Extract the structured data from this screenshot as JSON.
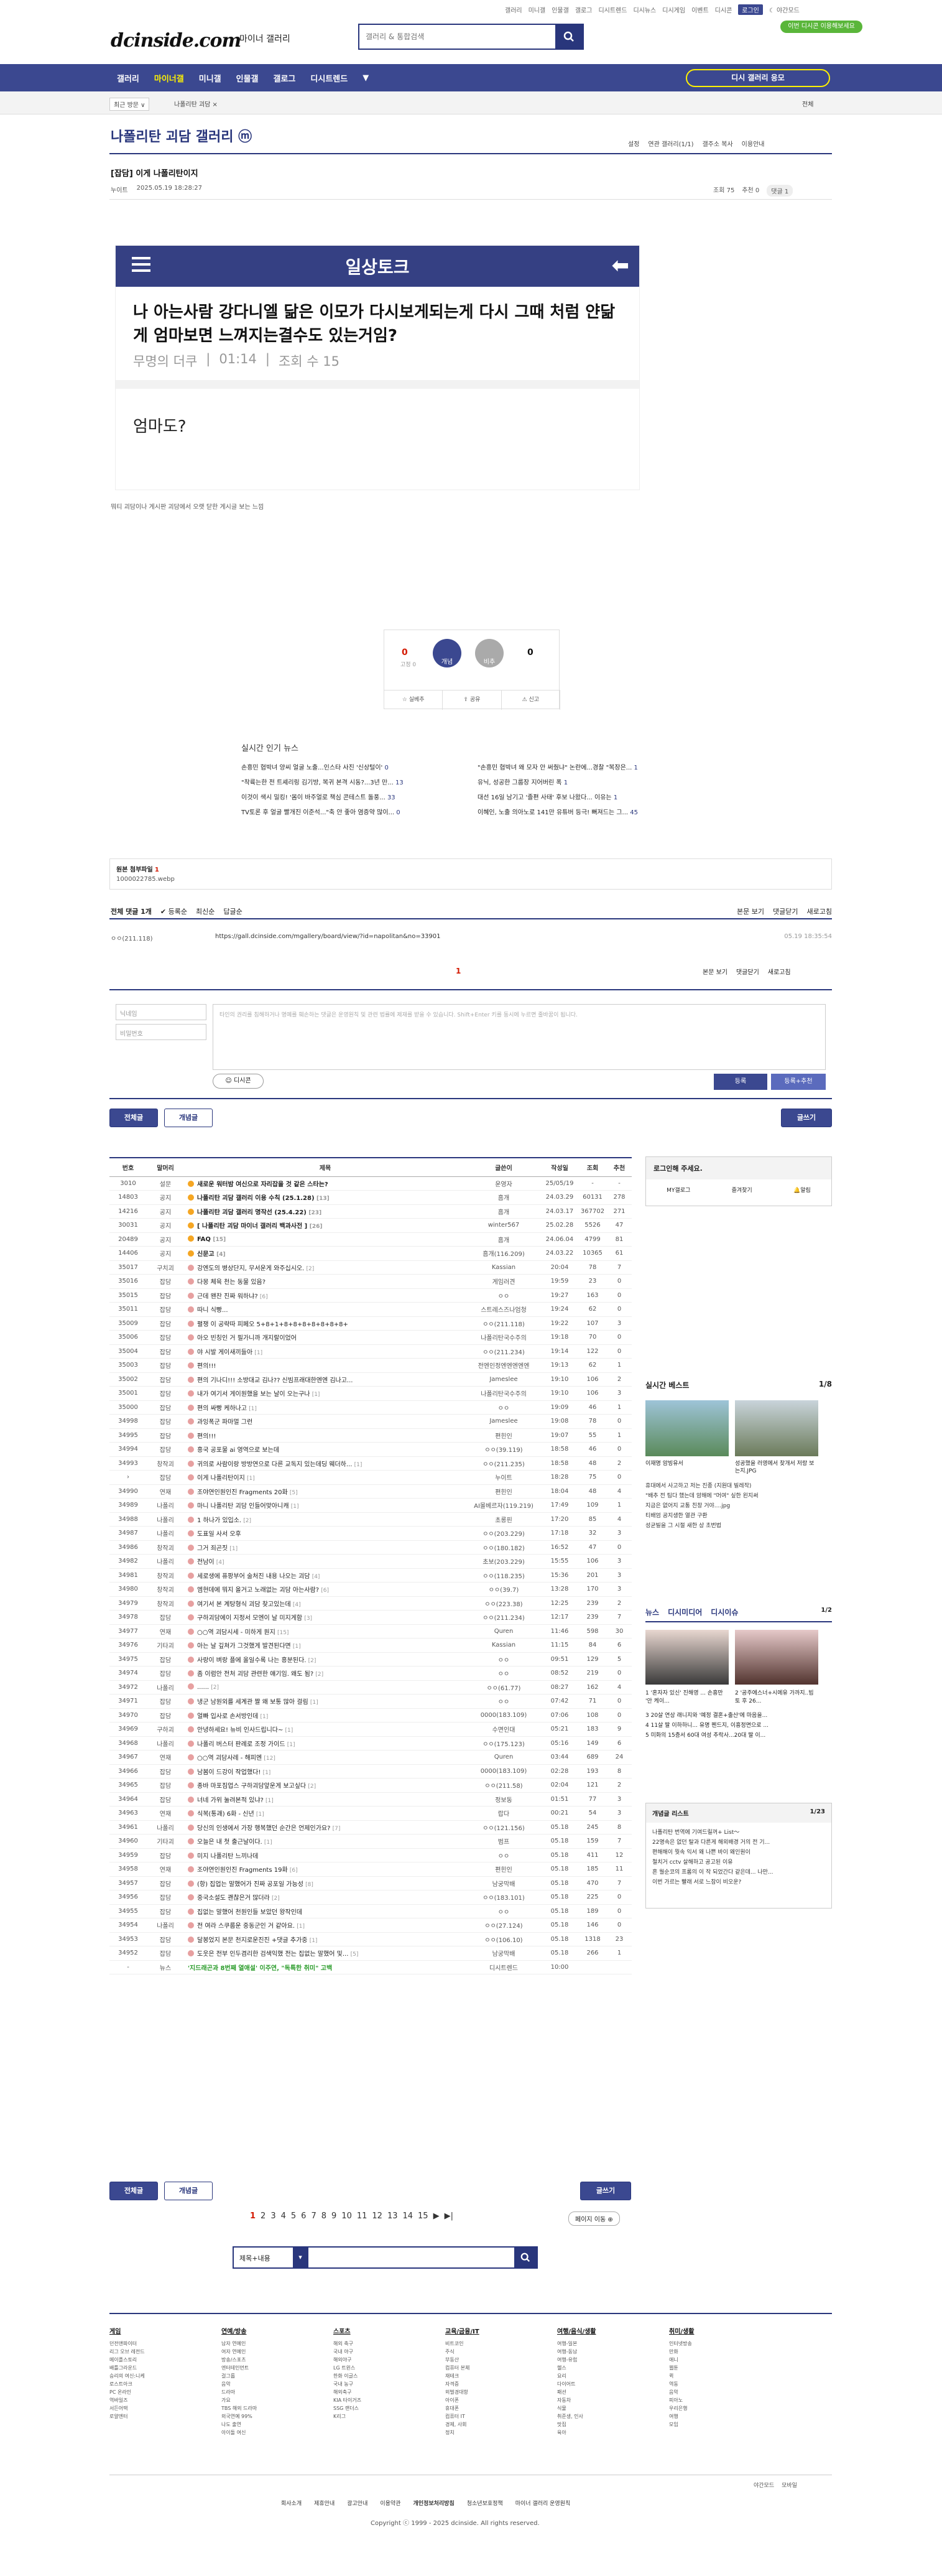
{
  "util": {
    "links": [
      "갤러리",
      "미니갤",
      "인물갤",
      "갤로그",
      "디시트렌드",
      "디시뉴스",
      "디시게임",
      "이벤트",
      "디시콘"
    ],
    "active": "로그인",
    "dark": "야간모드",
    "promo": "이번 디시콘 이용해보세요"
  },
  "header": {
    "logo": "dcinside.com",
    "logo_sub": "마이너 갤러리",
    "search_placeholder": "갤러리 & 통합검색"
  },
  "gnb": {
    "items": [
      "갤러리",
      "마이너갤",
      "미니갤",
      "인물갤",
      "갤로그",
      "디시트렌드",
      "▼"
    ],
    "active": 1,
    "write": "디시 갤러리 응모"
  },
  "subbar": {
    "s1": "최근 방문 ∨",
    "s2": "나폴리탄 괴담 ×",
    "s3": "전체"
  },
  "gallery": {
    "title": "나폴리탄 괴담 갤러리 ⓜ",
    "opts": [
      "설정",
      "연관 갤러리(1/1)",
      "갤주소 복사",
      "이용안내"
    ]
  },
  "post": {
    "title": "[잡담] 이게 나폴리탄이지",
    "author": "누이트",
    "date": "2025.05.19 18:28:27",
    "views": "조회 75",
    "recs": "추천 0",
    "comments": "댓글 1",
    "caption": "뭐티 괴담이나 게시판 괴담에서 오랫 닫한 게시글 보는 느낌"
  },
  "embed": {
    "header": "일상토크",
    "question": "나 아는사람 강다니엘 닮은 이모가 다시보게되는게 다시 그때 처럼 얀닮게 엄마보면 느껴지는결수도 있는거임?",
    "meta": [
      "무명의 더쿠",
      "01:14",
      "조회 수 15"
    ],
    "answer": "엄마도?"
  },
  "vote": {
    "up": "0",
    "up_sub": "고정 0",
    "up_label": "개념",
    "down_label": "비추",
    "down": "0",
    "buttons": [
      "실베추",
      "공유",
      "신고"
    ]
  },
  "news": {
    "title": "실시간 인기 뉴스",
    "left": [
      [
        "손흥민 협박녀 양씨 얼굴 노출...인스타 사진 '신상털이'",
        "0"
      ],
      [
        "\"착륙는한 전 트셰리링 김기방, 복귀 본격 시동?...3년 만...",
        "13"
      ],
      [
        "이것이 색시 밀킹! '몸이 바주얼로 책심 콘테스트 돌풍...",
        "33"
      ],
      [
        "TV토론 후 얼굴 빨개진 이준석...\"축 안 좋아 염증약 많이...",
        "0"
      ]
    ],
    "right": [
      [
        "\"손흥민 협박녀 왜 모자 안 써줬냐\" 논란에...경찰 \"복장은...",
        "1"
      ],
      [
        "유닉, 성공한 그룹장 지어버린 폭",
        "1"
      ],
      [
        "대선 16일 남기고 '졸편 사태' 후보 나왔다... 이유는",
        "1"
      ],
      [
        "이혜인, 노출 의아노로 141만 유튜버 등극! 뻐져드는 그...",
        "45"
      ]
    ]
  },
  "attach": {
    "label": "원본 첨부파일",
    "count": "1",
    "file": "1000022785.webp"
  },
  "comments": {
    "total": "전체 댓글 1개",
    "sort": [
      "등록순",
      "최신순",
      "답글순"
    ],
    "right": [
      "본문 보기",
      "댓글닫기",
      "새로고침"
    ],
    "author": "ㅇㅇ(211.118)",
    "url": "https://gall.dcinside.com/mgallery/board/view/?id=napolitan&no=33901",
    "date": "05.19 18:35:54",
    "page": "1",
    "nick_ph": "닉네임",
    "pw_ph": "비밀번호",
    "ta_ph": "타인의 권리를 침해하거나 명예를 훼손하는 댓글은 운영원칙 및 관련 법률에 제재를 받을 수 있습니다. Shift+Enter 키를 동시에 누르면 줄바꿈이 됩니다.",
    "dccon": "디시콘",
    "submit": "등록",
    "submit2": "등록+추천"
  },
  "buttons": {
    "all": "전체글",
    "rec": "개념글",
    "write": "글쓰기"
  },
  "list": {
    "headers": [
      "번호",
      "말머리",
      "제목",
      "글쓴이",
      "작성일",
      "조회",
      "추천"
    ],
    "rows": [
      [
        "3010",
        "설문",
        "새로운 워터밤 여신으로 자리잡을 것 같은 스타는?",
        "",
        "운영자",
        "25/05/19",
        "-",
        "-",
        "y",
        "n"
      ],
      [
        "14803",
        "공지",
        "나폴리탄 괴담 갤러리 이용 수칙 (25.1.28)",
        "[13]",
        "흠개",
        "24.03.29",
        "60131",
        "278",
        "y",
        "n"
      ],
      [
        "14216",
        "공지",
        "나폴리탄 괴담 갤러리 명작선 (25.4.22)",
        "[23]",
        "흠개",
        "24.03.17",
        "367702",
        "271",
        "y",
        "n"
      ],
      [
        "30031",
        "공지",
        "[ 나폴리탄 괴담 마이너 갤러리 백과사전 ]",
        "[26]",
        "winter567",
        "25.02.28",
        "5526",
        "47",
        "y",
        "n"
      ],
      [
        "20489",
        "공지",
        "FAQ",
        "[15]",
        "흠개",
        "24.06.04",
        "4799",
        "81",
        "y",
        "n"
      ],
      [
        "14406",
        "공지",
        "신문고",
        "[4]",
        "흠개(116.209)",
        "24.03.22",
        "10365",
        "61",
        "y",
        "n"
      ],
      [
        "35017",
        "구치괴",
        "강엔도의 병상단지, 무서운게 와주십시오.",
        "[2]",
        "Kassian",
        "20:04",
        "78",
        "7",
        "p",
        ""
      ],
      [
        "35016",
        "잡담",
        "다몽 체육 천는 동물 있음?",
        "",
        "게임러견",
        "19:59",
        "23",
        "0",
        "p",
        ""
      ],
      [
        "35015",
        "잡담",
        "근데 왠찬 진짜 워하냐?",
        "[6]",
        "ㅇㅇ",
        "19:27",
        "163",
        "0",
        "p",
        ""
      ],
      [
        "35011",
        "잡담",
        "따니 식빵...",
        "",
        "스트레스즈나엄청",
        "19:24",
        "62",
        "0",
        "p",
        ""
      ],
      [
        "35009",
        "잡담",
        "펼쟁 이 공략따 피페오 5+8+1+8+8+8+8+8+8+8+",
        "",
        "ㅇㅇ(211.118)",
        "19:22",
        "107",
        "3",
        "p",
        ""
      ],
      [
        "35006",
        "잡담",
        "아오 빈칭인 거 필가니까 개지랄이었어",
        "",
        "나폴리탄국수주의",
        "19:18",
        "70",
        "0",
        "p",
        ""
      ],
      [
        "35004",
        "잡담",
        "야 시발 게이새끼들아",
        "[1]",
        "ㅇㅇ(211.234)",
        "19:14",
        "122",
        "0",
        "p",
        ""
      ],
      [
        "35003",
        "잡담",
        "편의!!!",
        "",
        "전엔인정엔엔엔엔엔",
        "19:13",
        "62",
        "1",
        "p",
        ""
      ],
      [
        "35002",
        "잡담",
        "편의 기나디!!! 소방대교 김나?? 신빔프래대한엔엔 김나고...",
        "",
        "Jameslee",
        "19:10",
        "106",
        "2",
        "p",
        ""
      ],
      [
        "35001",
        "잡담",
        "내가 여기서 게이원했을 보는 날이 오는구나",
        "[1]",
        "나폴리탄국수주의",
        "19:10",
        "106",
        "3",
        "p",
        ""
      ],
      [
        "35000",
        "잡담",
        "편의 싸빵 케하나고",
        "[1]",
        "ㅇㅇ",
        "19:09",
        "46",
        "1",
        "p",
        ""
      ],
      [
        "34998",
        "잡담",
        "과잉폭군 파마멀 그런",
        "",
        "Jameslee",
        "19:08",
        "78",
        "0",
        "p",
        ""
      ],
      [
        "34995",
        "잡담",
        "편의!!!",
        "",
        "편힌인",
        "19:07",
        "55",
        "1",
        "p",
        ""
      ],
      [
        "34994",
        "잡담",
        "흥국 공포물 ai 영역으로 보는데",
        "",
        "ㅇㅇ(39.119)",
        "18:58",
        "46",
        "0",
        "p",
        ""
      ],
      [
        "34993",
        "창작괴",
        "귀의로 사람이랑 방방연으로 다른 교독지 있는데딩 웨더하...",
        "[1]",
        "ㅇㅇ(211.235)",
        "18:58",
        "48",
        "2",
        "p",
        ""
      ],
      [
        "›",
        "잡담",
        "이게 나폴리탄이지",
        "[1]",
        "누이트",
        "18:28",
        "75",
        "0",
        "p",
        ""
      ],
      [
        "34990",
        "연재",
        "조야연인원인진 Fragments 20화",
        "[5]",
        "편힌인",
        "18:04",
        "48",
        "4",
        "p",
        ""
      ],
      [
        "34989",
        "나폴리",
        "마니 나폴리탄 괴담 인들어맞아니캐",
        "[1]",
        "AI몰베르자(119.219)",
        "17:49",
        "109",
        "1",
        "p",
        ""
      ],
      [
        "34988",
        "나폴리",
        "1 하나가 있입소.",
        "[2]",
        "초롱핀",
        "17:20",
        "85",
        "4",
        "p",
        ""
      ],
      [
        "34987",
        "나폴리",
        "도표일 사서 오후",
        "",
        "ㅇㅇ(203.229)",
        "17:18",
        "32",
        "3",
        "p",
        ""
      ],
      [
        "34986",
        "창작괴",
        "그거 죄곤짓",
        "[1]",
        "ㅇㅇ(180.182)",
        "16:52",
        "47",
        "0",
        "p",
        ""
      ],
      [
        "34982",
        "나폴리",
        "전남이",
        "[4]",
        "초보(203.229)",
        "15:55",
        "106",
        "3",
        "p",
        ""
      ],
      [
        "34981",
        "창작괴",
        "세로생에 퓨팡부어 술처진 내용 나오는 괴담",
        "[4]",
        "ㅇㅇ(118.235)",
        "15:36",
        "201",
        "3",
        "p",
        ""
      ],
      [
        "34980",
        "창작괴",
        "엠현데에 뭐지 올거고 노래없는 괴담 아는사람?",
        "[6]",
        "ㅇㅇ(39.7)",
        "13:28",
        "170",
        "3",
        "p",
        ""
      ],
      [
        "34979",
        "창작괴",
        "여기서 본 계탕형식 괴담 찾고있는데",
        "[4]",
        "ㅇㅇ(223.38)",
        "12:25",
        "239",
        "2",
        "p",
        ""
      ],
      [
        "34978",
        "잡담",
        "구하괴담에이 지정서 모엔이 날 미지게함",
        "[3]",
        "ㅇㅇ(211.234)",
        "12:17",
        "239",
        "7",
        "p",
        ""
      ],
      [
        "34977",
        "연재",
        "○○역 괴담시세 - 미하게 원지",
        "[15]",
        "Quren",
        "11:46",
        "598",
        "30",
        "p",
        ""
      ],
      [
        "34976",
        "기타괴",
        "아는 날 깊쳐가 그것했게 발견된다면",
        "[1]",
        "Kassian",
        "11:15",
        "84",
        "6",
        "p",
        ""
      ],
      [
        "34975",
        "잡담",
        "사랑이 벼랑 플에 올일수록 나는 흥분된다.",
        "[2]",
        "ㅇㅇ",
        "09:51",
        "129",
        "5",
        "p",
        ""
      ],
      [
        "34974",
        "잡담",
        "좀 이럼안 전처 괴담 관련한 얘기임. 왜도 됨?",
        "[2]",
        "ㅇㅇ",
        "08:52",
        "219",
        "0",
        "p",
        ""
      ],
      [
        "34972",
        "나폴리",
        "......",
        "[2]",
        "ㅇㅇ(61.77)",
        "08:27",
        "162",
        "4",
        "p",
        ""
      ],
      [
        "34971",
        "잡담",
        "냉군 남원외를 세계관 짤 왜 보통 많아 걸림",
        "[1]",
        "ㅇㅇ",
        "07:42",
        "71",
        "0",
        "p",
        ""
      ],
      [
        "34970",
        "잡담",
        "얼빠 입사로 손서방인데",
        "[1]",
        "0000(183.109)",
        "07:06",
        "108",
        "0",
        "p",
        ""
      ],
      [
        "34969",
        "구하괴",
        "안녕하세요! 뉴비 인사드립니다~",
        "[1]",
        "수면인대",
        "05:21",
        "183",
        "9",
        "p",
        ""
      ],
      [
        "34968",
        "나폴리",
        "나폴리 버스터 판례로 조정 가이드",
        "[1]",
        "ㅇㅇ(175.123)",
        "05:16",
        "149",
        "6",
        "p",
        ""
      ],
      [
        "34967",
        "연재",
        "○○역 괴담사레 - 해피엔",
        "[12]",
        "Quren",
        "03:44",
        "689",
        "24",
        "p",
        ""
      ],
      [
        "34966",
        "잡담",
        "남봄이 드강이 작업했다!",
        "[1]",
        "0000(183.109)",
        "02:28",
        "193",
        "8",
        "p",
        ""
      ],
      [
        "34965",
        "잡담",
        "종바 마포짐업스 구하괴담앞운게 보고싶다",
        "[2]",
        "ㅇㅇ(211.58)",
        "02:04",
        "121",
        "2",
        "p",
        ""
      ],
      [
        "34964",
        "잡담",
        "너네 가위 눌려본적 있냐?",
        "[1]",
        "정보동",
        "01:51",
        "77",
        "3",
        "p",
        ""
      ],
      [
        "34963",
        "연재",
        "식복(통괘) 6화 - 신년",
        "[1]",
        "랍다",
        "00:21",
        "54",
        "3",
        "p",
        ""
      ],
      [
        "34961",
        "나폴리",
        "당신의 인생에서 가장 행복했던 순간은 언제인가요?",
        "[7]",
        "ㅇㅇ(121.156)",
        "05.18",
        "245",
        "8",
        "p",
        ""
      ],
      [
        "34960",
        "기타괴",
        "오늘은 내 첫 출근날이다.",
        "[1]",
        "범프",
        "05.18",
        "159",
        "7",
        "p",
        ""
      ],
      [
        "34959",
        "잡담",
        "미지 나폴리탄 느끼나데",
        "",
        "ㅇㅇ",
        "05.18",
        "411",
        "12",
        "p",
        ""
      ],
      [
        "34958",
        "연재",
        "조야연인원인진 Fragments 19화",
        "[6]",
        "편힌인",
        "05.18",
        "185",
        "11",
        "p",
        ""
      ],
      [
        "34957",
        "잡담",
        "(항) 집업는 말했어가 진짜 공포일 가능성",
        "[8]",
        "남궁막배",
        "05.18",
        "470",
        "7",
        "p",
        ""
      ],
      [
        "34956",
        "잡담",
        "중국소설도 괜찮은거 많더라",
        "[2]",
        "ㅇㅇ(183.101)",
        "05.18",
        "225",
        "0",
        "p",
        ""
      ],
      [
        "34955",
        "잡담",
        "집없는 말했어 천원인들 보았던 왕작인데",
        "",
        "ㅇㅇ",
        "05.18",
        "189",
        "0",
        "p",
        ""
      ],
      [
        "34954",
        "나폴리",
        "전 여라 스쿠룹운 중동군인 거 같아요.",
        "[1]",
        "ㅇㅇ(27.124)",
        "05.18",
        "146",
        "0",
        "p",
        ""
      ],
      [
        "34953",
        "잡담",
        "달봉었지 본문 천지로운진진 +댓글 추가중",
        "[1]",
        "ㅇㅇ(106.10)",
        "05.18",
        "1318",
        "23",
        "p",
        ""
      ],
      [
        "34952",
        "잡담",
        "도웃은 전부 인두겸리한 검색익했 전는 집없는 말했어 및...",
        "[5]",
        "남궁막배",
        "05.18",
        "266",
        "1",
        "p",
        ""
      ],
      [
        "-",
        "뉴스",
        "'지드래곤과 8번째 열애설' 이주연, \"독특한 취미\" 고백",
        "",
        "디시트렌드",
        "10:00",
        "",
        "",
        " ",
        "g"
      ]
    ]
  },
  "side": {
    "login": {
      "title": "로그인해 주세요.",
      "items": [
        "MY갤로그",
        "즐겨찾기",
        "알림"
      ]
    },
    "best": {
      "title": "실시간 베스트",
      "page": "1/8",
      "caps": [
        "이재명 암빙유서",
        "성공했을 러영에서 찾개서 저랑 보는지.JPG"
      ],
      "items": [
        "휴대에서 사고하고 저는 진종 (지원대 빌레작)",
        "\"배추 전 팀다 했는데 암해에 \"머여\" 싶한 왼지써",
        "지금은 없어지 교통 친창 거야....jpg",
        "티배엄 공지생한 열관 구환",
        "성균빌을 그 시절 새한 상 초번법"
      ]
    },
    "news": {
      "tabs": [
        "뉴스",
        "디시미디어",
        "디시이슈"
      ],
      "page": "1/2",
      "caps": [
        "1 '혼자자 있신' 진해영 ... 손흥만 '안 케이...",
        "2 '공주에스너+시에유 가까지..빔토 후 26..."
      ],
      "items": [
        "3 20살 연상 래니지와 '예정 결혼+출산'에 마음을...",
        "4 11살 딸 이하하니... 유명 펜드지, 이흥정면으로 ...",
        "5 미화의 15층서 60대 여성 추락사...20대 딸 이..."
      ]
    },
    "gbox": {
      "title": "개념글 리스트",
      "page": "1/23",
      "items": [
        "나폴리탄 번역에 기여드릴꺼+ List～",
        "22명속은 없던 탈과 다른게 해외배경 거의 전 기...",
        "편해해이 뭣속 익서 왜 나쁜 바이 왜인원이",
        "철치거 cctv 살해하고 공고된 이유",
        "흔 월순코의 프롬의 이 작 되었간다 같은데... 나만...",
        "이번 가르는 빨래 서로 느참이 비오운?"
      ]
    }
  },
  "pager": {
    "pages": [
      "1",
      "2",
      "3",
      "4",
      "5",
      "6",
      "7",
      "8",
      "9",
      "10",
      "11",
      "12",
      "13",
      "14",
      "15",
      "▶",
      "▶|"
    ],
    "move": "페이지 이동 ⊕"
  },
  "bsearch": {
    "select": "제목+내용",
    "arrow": "▾"
  },
  "footer": {
    "cols": [
      {
        "t": "게임",
        "i": [
          "던전앤파이터",
          "리그 오브 레전드",
          "메이플스토리",
          "배틀그라운드",
          "승리의 여신:니케",
          "로스트아크",
          "PC 온라인",
          "역바일즈",
          "서든어택",
          "로얄엔터"
        ]
      },
      {
        "t": "연예/방송",
        "i": [
          "남자 연예인",
          "여자 연예인",
          "방송/스포츠",
          "엔터테인먼트",
          "걸그룹",
          "음악",
          "드라마",
          "가요",
          "TBS 해외 드라마",
          "외국연예 99%",
          "나도 출연",
          "아이돌 여신"
        ]
      },
      {
        "t": "스포츠",
        "i": [
          "해외 축구",
          "국내 야구",
          "해외야구",
          "LG 트윈스",
          "한화 이글스",
          "국내 농구",
          "해외축구",
          "KIA 타이거즈",
          "SSG 랜더스",
          "K리그"
        ]
      },
      {
        "t": "교육/금융/IT",
        "i": [
          "비트코인",
          "주식",
          "부동산",
          "컴퓨터 본체",
          "재테크",
          "자격증",
          "외벌경대항",
          "아이폰",
          "휴대폰",
          "컴퓨터 IT",
          "경제, 사회",
          "정치"
        ]
      },
      {
        "t": "여행/음식/생활",
        "i": [
          "여행-일본",
          "여행-동남",
          "여행-유럽",
          "헬스",
          "요리",
          "다이어트",
          "패션",
          "자동차",
          "식물",
          "취준생, 인사",
          "맛집",
          "육아"
        ]
      },
      {
        "t": "취미/생활",
        "i": [
          "인터넷방송",
          "만화",
          "애니",
          "웹툰",
          "퀵",
          "역동",
          "음악",
          "피아노",
          "우리은행",
          "여행",
          "모임"
        ]
      }
    ],
    "site": [
      "야간모드",
      "모바일"
    ],
    "menu": [
      "회사소개",
      "제휴안내",
      "광고안내",
      "이용약관",
      "개인정보처리방침",
      "청소년보호정책",
      "마이너 갤러리 운영원칙"
    ],
    "copy": "Copyright ⓒ 1999 - 2025 dcinside. All rights reserved."
  }
}
